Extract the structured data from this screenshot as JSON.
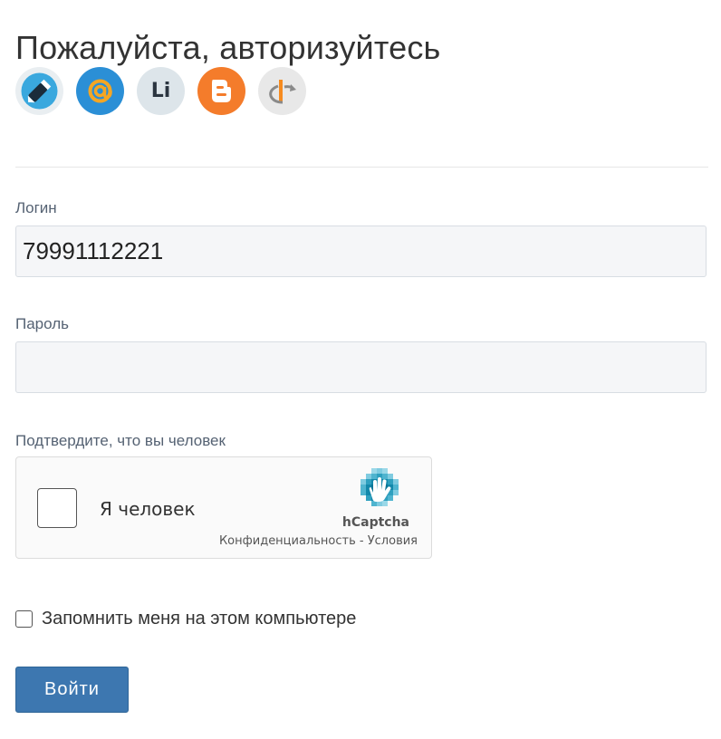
{
  "page": {
    "title": "Пожалуйста, авторизуйтесь"
  },
  "providers": [
    {
      "icon": "livejournal-icon",
      "color": "#3aa8de"
    },
    {
      "icon": "mailru-icon",
      "color": "#2b8fd6"
    },
    {
      "icon": "liveinternet-icon",
      "color": "#dde5ea",
      "text": "Li"
    },
    {
      "icon": "blogger-icon",
      "color": "#f47c2b"
    },
    {
      "icon": "openid-icon",
      "color": "#e8e8e8"
    }
  ],
  "login": {
    "label": "Логин",
    "value": "79991112221"
  },
  "password": {
    "label": "Пароль",
    "value": ""
  },
  "captcha": {
    "prompt": "Подтвердите, что вы человек",
    "checkbox_label": "Я человек",
    "brand": "hCaptcha",
    "privacy_link": "Конфиденциальность",
    "separator": " - ",
    "terms_link": "Условия",
    "accent_color": "#0074bf"
  },
  "remember": {
    "label": "Запомнить меня на этом компьютере",
    "checked": false
  },
  "submit": {
    "label": "Войти",
    "color": "#3d77b0"
  }
}
